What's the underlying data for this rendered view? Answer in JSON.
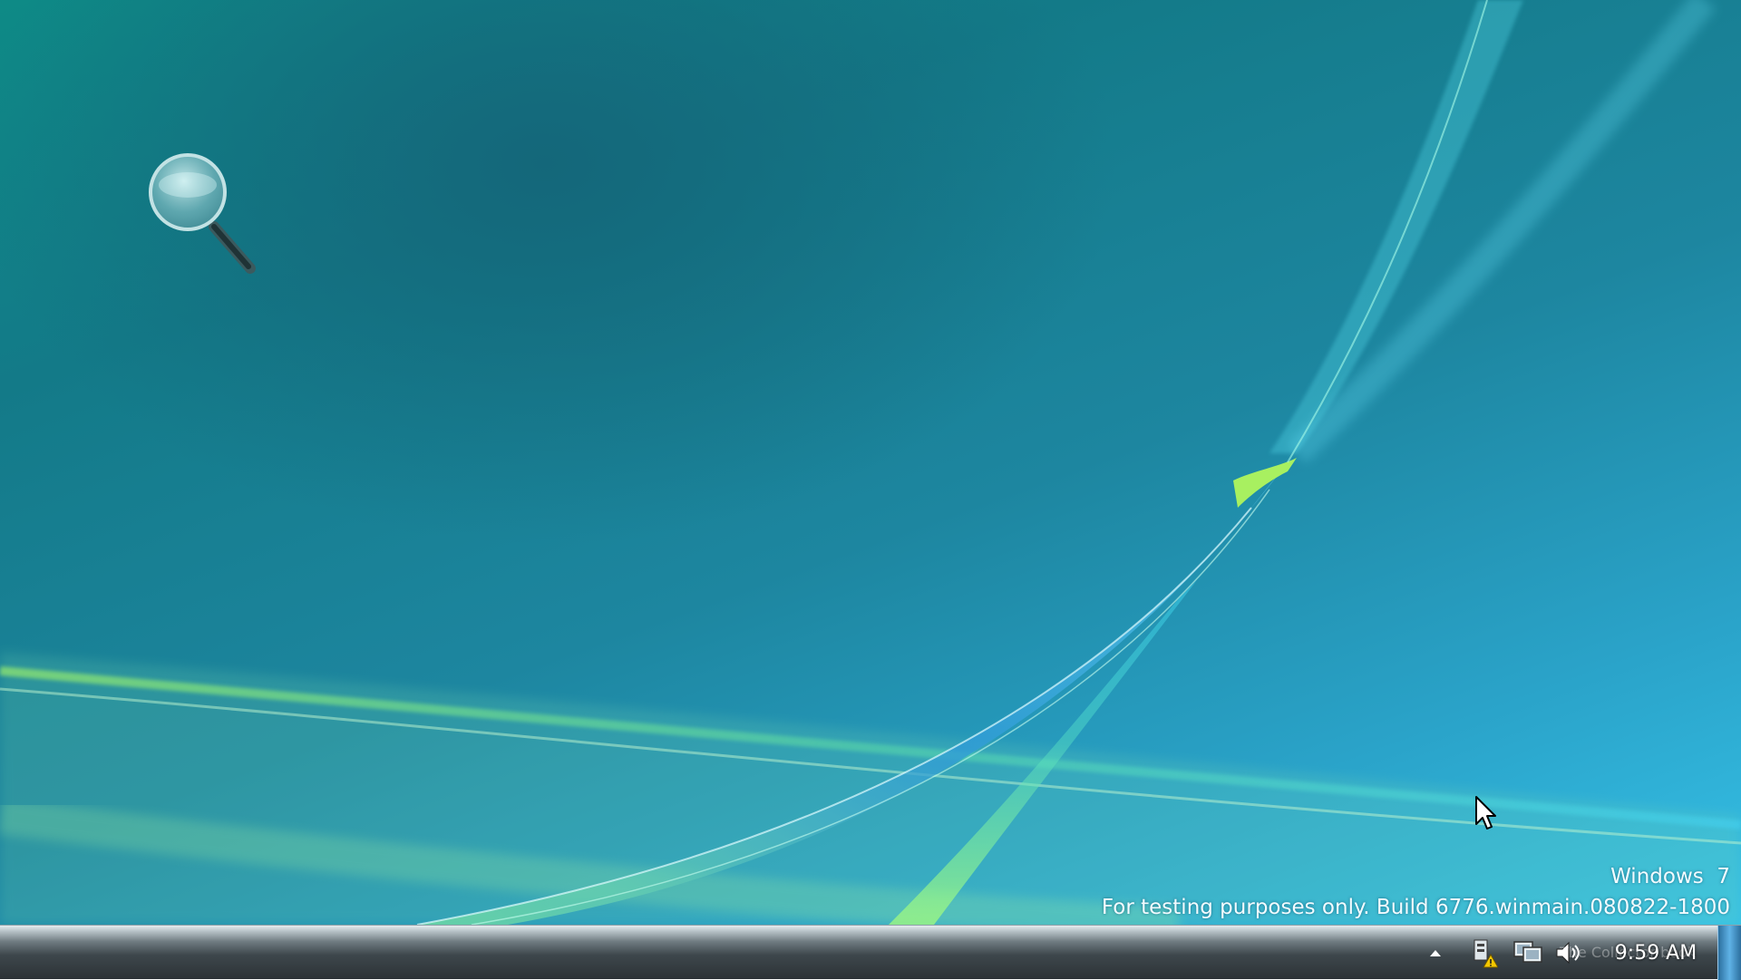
{
  "desktop": {
    "wallpaper": "Windows aurora wallpaper",
    "accent_colors": {
      "teal": "#137a88",
      "cyan": "#35c0e6",
      "green": "#7fe86a"
    }
  },
  "watermark": {
    "line1": "Windows  7",
    "line2": "For testing purposes only. Build 6776.winmain.080822-1800"
  },
  "taskbar": {
    "tray": {
      "show_hidden_icon": "triangle-up-icon",
      "action_center_icon": "flag-warning-icon",
      "network_icon": "network-icon",
      "volume_icon": "speaker-icon",
      "overlay_text": "The Collector book",
      "clock": "9:59 AM"
    }
  }
}
